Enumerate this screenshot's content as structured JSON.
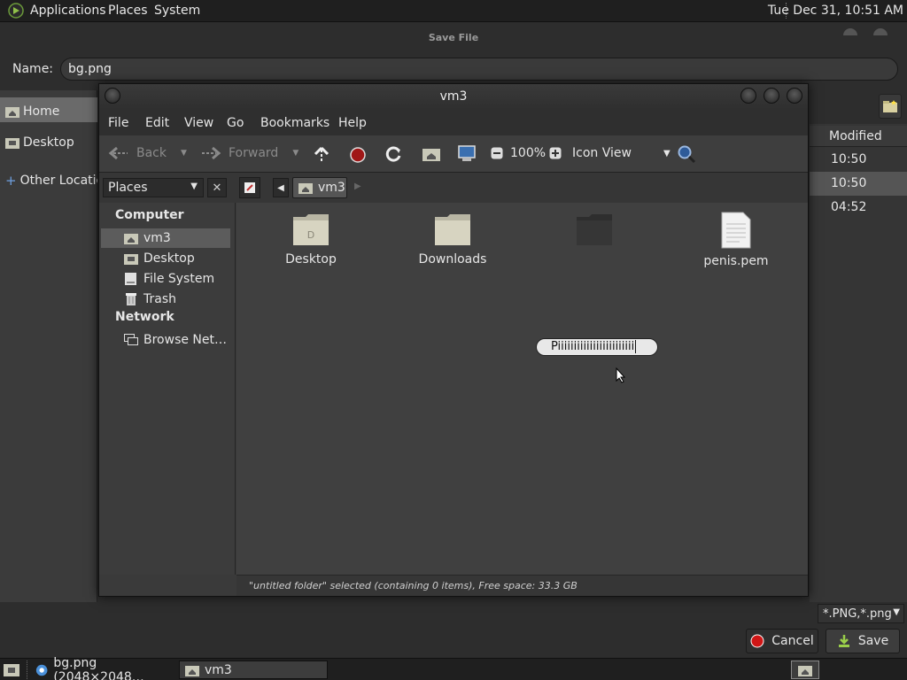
{
  "top_panel": {
    "menus": [
      "Applications",
      "Places",
      "System"
    ],
    "clock": "Tue Dec 31, 10:51 AM"
  },
  "save_dialog": {
    "title": "Save File",
    "name_label": "Name:",
    "name_value": "bg.png",
    "sidebar": [
      "Home",
      "Desktop",
      "Other Locations"
    ],
    "list_header": "Modified",
    "list_rows": [
      "10:50",
      "10:50",
      "04:52"
    ],
    "filter": "*.PNG,*.png",
    "cancel_label": "Cancel",
    "save_label": "Save"
  },
  "file_manager": {
    "title": "vm3",
    "menu": [
      "File",
      "Edit",
      "View",
      "Go",
      "Bookmarks",
      "Help"
    ],
    "toolbar": {
      "back": "Back",
      "forward": "Forward",
      "zoom": "100%",
      "view_mode": "Icon View"
    },
    "places_label": "Places",
    "path_button": "vm3",
    "sidebar": {
      "computer_heading": "Computer",
      "computer_items": [
        "vm3",
        "Desktop",
        "File System",
        "Trash"
      ],
      "network_heading": "Network",
      "network_items": [
        "Browse Net…"
      ]
    },
    "files": [
      {
        "name": "Desktop",
        "icon": "desktop-folder-icon"
      },
      {
        "name": "Downloads",
        "icon": "folder-icon"
      },
      {
        "name": "Piiiiiiiiiiiiiiiiiiiiiiii",
        "icon": "folder-icon",
        "renaming": true
      },
      {
        "name": "penis.pem",
        "icon": "text-file-icon"
      }
    ],
    "status": "\"untitled folder\" selected (containing 0 items), Free space: 33.3 GB"
  },
  "taskbar": {
    "tasks": [
      "bg.png (2048×2048…",
      "vm3"
    ]
  },
  "colors": {
    "panel_bg": "#1f1f1f",
    "window_bg": "#3a3a3a",
    "cancel_red": "#d01616"
  }
}
